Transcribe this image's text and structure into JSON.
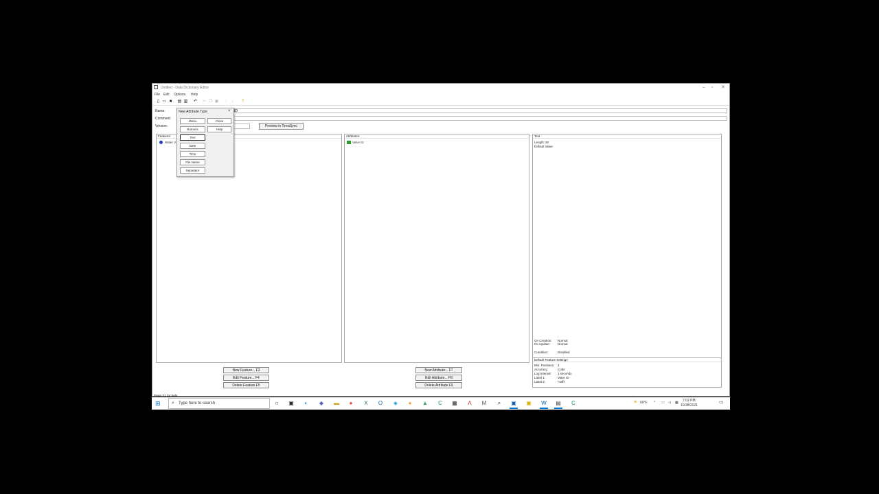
{
  "window": {
    "title": "Untitled - Data Dictionary Editor",
    "controls": {
      "minimize": "–",
      "maximize": "▫",
      "close": "✕"
    }
  },
  "menubar": [
    "File",
    "Edit",
    "Options",
    "Help"
  ],
  "toolbar_icons": [
    "new-icon",
    "open-icon",
    "save-icon",
    "print-icon",
    "print-preview-icon",
    "undo-icon",
    "cut-icon",
    "copy-icon",
    "paste-icon",
    "move-up-icon",
    "move-down-icon",
    "help-icon"
  ],
  "form": {
    "name_label": "Name:",
    "name_value": "ID",
    "comment_label": "Comment:",
    "version_label": "Version:",
    "preview_button": "Preview in TerraSync"
  },
  "panels": {
    "features": {
      "title": "Features:",
      "items": [
        {
          "label": "Water V..."
        }
      ]
    },
    "attributes": {
      "title": "Attributes:",
      "items": [
        {
          "label": "Valve ID"
        }
      ]
    },
    "details": {
      "title": "Text",
      "length_label": "Length:",
      "length_value": "30",
      "default_label": "Default Value:",
      "on_creation_label": "On Creation:",
      "on_creation_value": "Normal",
      "on_update_label": "On Update:",
      "on_update_value": "Normal",
      "condition_label": "Condition:",
      "condition_value": "Disabled"
    },
    "default_settings": {
      "title": "Default Feature Settings:",
      "rows": [
        {
          "label": "Min. Positions:",
          "value": "1"
        },
        {
          "label": "Accuracy:",
          "value": "Code"
        },
        {
          "label": "Log Interval:",
          "value": "1 seconds"
        },
        {
          "label": "Label 1:",
          "value": "Valve ID"
        },
        {
          "label": "Label 2:",
          "value": "<Off>"
        }
      ]
    }
  },
  "buttons": {
    "new_feature": "New Feature... F3",
    "edit_feature": "Edit Feature... F4",
    "delete_feature": "Delete Feature F5",
    "new_attribute": "New Attribute... F7",
    "edit_attribute": "Edit Attribute... F8",
    "delete_attribute": "Delete Attribute F9"
  },
  "status_bar": "Press F1 for help",
  "dialog": {
    "title": "New Attribute Type",
    "close_glyph": "×",
    "type_buttons": [
      "Menu",
      "Numeric",
      "Text",
      "Date",
      "Time",
      "File Name",
      "Separator"
    ],
    "close_button": "Close",
    "help_button": "Help"
  },
  "taskbar": {
    "search_placeholder": "Type here to search",
    "weather": "69°F",
    "time": "7:02 PM",
    "date": "10/28/2021"
  }
}
